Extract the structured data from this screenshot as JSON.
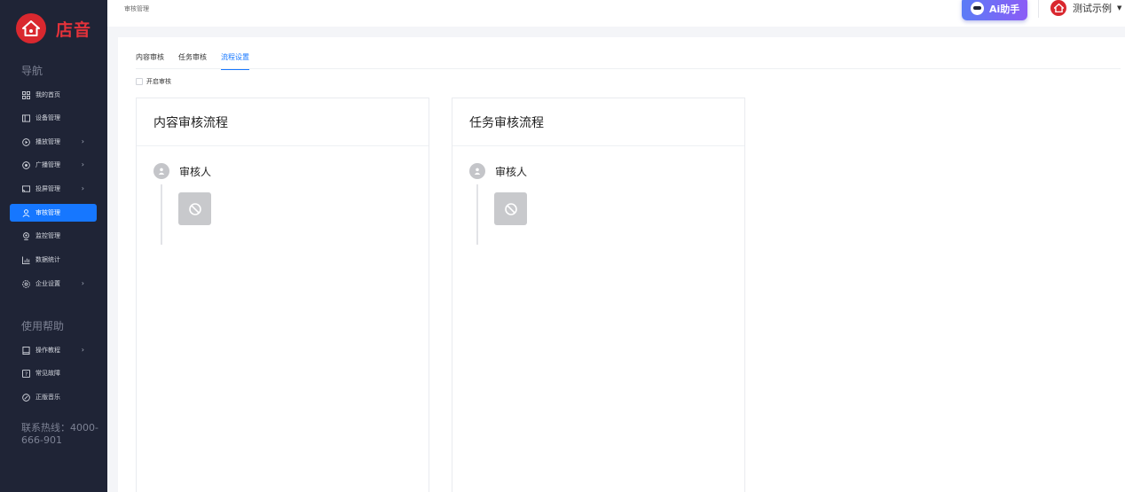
{
  "app": {
    "name": "店音"
  },
  "sidebar": {
    "nav_title": "导航",
    "nav_items": [
      {
        "label": "我的首页",
        "icon": "grid-icon",
        "arrow": false,
        "active": false
      },
      {
        "label": "设备管理",
        "icon": "device-icon",
        "arrow": false,
        "active": false
      },
      {
        "label": "播放管理",
        "icon": "play-icon",
        "arrow": true,
        "active": false
      },
      {
        "label": "广播管理",
        "icon": "broadcast-icon",
        "arrow": true,
        "active": false
      },
      {
        "label": "投屏管理",
        "icon": "cast-icon",
        "arrow": true,
        "active": false
      },
      {
        "label": "审核管理",
        "icon": "review-icon",
        "arrow": false,
        "active": true
      },
      {
        "label": "监控管理",
        "icon": "camera-icon",
        "arrow": false,
        "active": false
      },
      {
        "label": "数据统计",
        "icon": "chart-icon",
        "arrow": false,
        "active": false
      },
      {
        "label": "企业设置",
        "icon": "gear-icon",
        "arrow": true,
        "active": false
      }
    ],
    "help_title": "使用帮助",
    "help_items": [
      {
        "label": "操作教程",
        "icon": "book-icon",
        "arrow": true
      },
      {
        "label": "常见故障",
        "icon": "question-icon",
        "arrow": false
      },
      {
        "label": "正版音乐",
        "icon": "music-icon",
        "arrow": false
      }
    ],
    "hotline": "联系热线：4000-666-901"
  },
  "topbar": {
    "breadcrumb": "审核管理",
    "ai_button": "Ai助手",
    "user_name": "测试示例"
  },
  "main": {
    "tabs": [
      {
        "label": "内容审核",
        "active": false
      },
      {
        "label": "任务审核",
        "active": false
      },
      {
        "label": "流程设置",
        "active": true
      }
    ],
    "enable_review_label": "开启审核",
    "enable_review_checked": false,
    "cards": [
      {
        "title": "内容审核流程",
        "node_label": "审核人"
      },
      {
        "title": "任务审核流程",
        "node_label": "审核人"
      }
    ]
  },
  "colors": {
    "sidebar_bg": "#1f2436",
    "accent": "#1677ff",
    "brand": "#d9282f"
  }
}
